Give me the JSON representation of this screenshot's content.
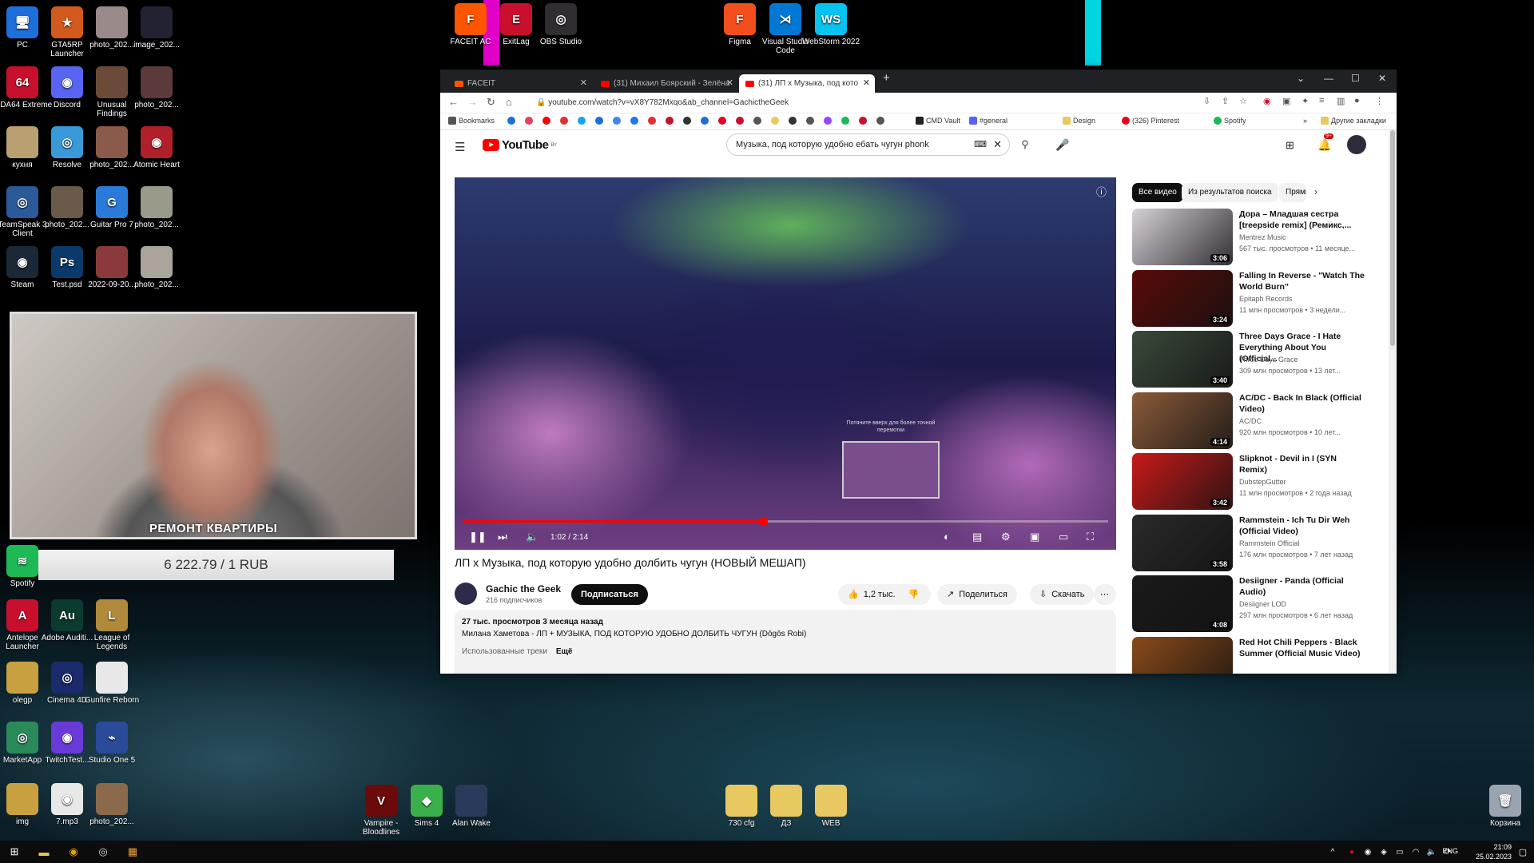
{
  "desktop": {
    "left_icons": [
      {
        "label": "PC",
        "color": "#1e6fd9",
        "glyph": "🖥"
      },
      {
        "label": "GTA5RP Launcher",
        "color": "#d25a1e",
        "glyph": "★"
      },
      {
        "label": "photo_202...",
        "color": "#9a8a8a",
        "glyph": ""
      },
      {
        "label": "image_202...",
        "color": "#222233",
        "glyph": ""
      },
      {
        "label": "AIDA64 Extreme",
        "color": "#c8102e",
        "glyph": "64"
      },
      {
        "label": "Discord",
        "color": "#5865f2",
        "glyph": "◉"
      },
      {
        "label": "Unusual Findings",
        "color": "#6b4a3a",
        "glyph": ""
      },
      {
        "label": "photo_202...",
        "color": "#5a3a3a",
        "glyph": ""
      },
      {
        "label": "кухня",
        "color": "#b8a070",
        "glyph": ""
      },
      {
        "label": "Resolve",
        "color": "#3a9ad9",
        "glyph": "◎"
      },
      {
        "label": "photo_202...",
        "color": "#8a5a4a",
        "glyph": ""
      },
      {
        "label": "Atomic Heart",
        "color": "#b0202a",
        "glyph": "◉"
      },
      {
        "label": "TeamSpeak 3 Client",
        "color": "#2a5a9a",
        "glyph": "◎"
      },
      {
        "label": "photo_202...",
        "color": "#6a5a4a",
        "glyph": ""
      },
      {
        "label": "Guitar Pro 7",
        "color": "#2a7ad9",
        "glyph": "G"
      },
      {
        "label": "photo_202...",
        "color": "#9a9a8a",
        "glyph": ""
      },
      {
        "label": "Steam",
        "color": "#1b2838",
        "glyph": "◉"
      },
      {
        "label": "Test.psd",
        "color": "#0a3a6a",
        "glyph": "Ps"
      },
      {
        "label": "2022-09-20...",
        "color": "#8a3a3a",
        "glyph": ""
      },
      {
        "label": "photo_202...",
        "color": "#aaa49a",
        "glyph": ""
      }
    ],
    "lower_icons": [
      {
        "label": "Spotify",
        "color": "#1db954",
        "glyph": "≋"
      },
      {
        "label": "Antelope Launcher",
        "color": "#c8102e",
        "glyph": "A"
      },
      {
        "label": "Adobe Auditi...",
        "color": "#0b3b2e",
        "glyph": "Au"
      },
      {
        "label": "League of Legends",
        "color": "#b08a3a",
        "glyph": "L"
      },
      {
        "label": "olegp",
        "color": "#c8a040",
        "glyph": ""
      },
      {
        "label": "Cinema 4D",
        "color": "#1a2a6a",
        "glyph": "◎"
      },
      {
        "label": "Gunfire Reborn",
        "color": "#e8e8e8",
        "glyph": ""
      },
      {
        "label": "MarketApp",
        "color": "#2a8a5a",
        "glyph": "◎"
      },
      {
        "label": "TwitchTest...",
        "color": "#6a3ad9",
        "glyph": "◉"
      },
      {
        "label": "Studio One 5",
        "color": "#2a4a9a",
        "glyph": "⌁"
      },
      {
        "label": "img",
        "color": "#c8a040",
        "glyph": ""
      },
      {
        "label": "7.mp3",
        "color": "#e8e8e8",
        "glyph": "◉"
      },
      {
        "label": "photo_202...",
        "color": "#8a6a4a",
        "glyph": ""
      }
    ],
    "top_icons": [
      {
        "label": "FACEIT AC",
        "color": "#ff5500",
        "glyph": "F"
      },
      {
        "label": "ExitLag",
        "color": "#c8102e",
        "glyph": "E"
      },
      {
        "label": "OBS Studio",
        "color": "#302e31",
        "glyph": "◎"
      },
      {
        "label": "Figma",
        "color": "#f24e1e",
        "glyph": "F"
      },
      {
        "label": "Visual Studio Code",
        "color": "#0078d4",
        "glyph": "⋊"
      },
      {
        "label": "WebStorm 2022",
        "color": "#07c3f2",
        "glyph": "WS"
      }
    ],
    "bottom_icons": [
      {
        "label": "Vampire - Bloodlines",
        "color": "#6a0a0a",
        "glyph": "V"
      },
      {
        "label": "Sims 4",
        "color": "#3ab04a",
        "glyph": "◆"
      },
      {
        "label": "Alan Wake",
        "color": "#2a3a5a",
        "glyph": ""
      },
      {
        "label": "730 cfg",
        "color": "#e8c860",
        "glyph": ""
      },
      {
        "label": "ДЗ",
        "color": "#e8c860",
        "glyph": ""
      },
      {
        "label": "WEB",
        "color": "#e8c860",
        "glyph": ""
      }
    ],
    "recycle_bin": "Корзина"
  },
  "webcam": {
    "caption": "РЕМОНТ КВАРТИРЫ"
  },
  "donation": {
    "text": "6 222.79 / 1 RUB"
  },
  "browser": {
    "tabs": [
      {
        "title": "FACEIT"
      },
      {
        "title": "(31) Михаил Боярский - Зелёна"
      },
      {
        "title": "(31) ЛП х Музыка, под кото"
      }
    ],
    "new_tab": "+",
    "url": "youtube.com/watch?v=vX8Y782Mxqo&ab_channel=GachictheGeek",
    "bookmarks": [
      {
        "label": "Bookmarks",
        "color": "#555"
      },
      {
        "label": "CMD Vault",
        "color": "#222"
      },
      {
        "label": "#general",
        "color": "#5865f2"
      },
      {
        "label": "Design",
        "color": "#e8c860"
      },
      {
        "label": "(326) Pinterest",
        "color": "#e60023"
      },
      {
        "label": "Spotify",
        "color": "#1db954"
      },
      {
        "label": "Другие закладки",
        "color": "#e8c860"
      }
    ]
  },
  "youtube": {
    "logo": "YouTube",
    "logo_sup": "BY",
    "search_query": "Музыка, под которую удобно ебать чугун phonk",
    "player": {
      "time": "1:02 / 2:14",
      "progress": 0.465,
      "preview_text": "Потяните вверх для более точной перемотки"
    },
    "video_title": "ЛП х Музыка, под которую удобно долбить чугун (НОВЫЙ МЕШАП)",
    "channel_name": "Gachic the Geek",
    "channel_subs": "216 подписчиков",
    "subscribe": "Подписаться",
    "likes": "1,2 тыс.",
    "share": "Поделиться",
    "download": "Скачать",
    "description": {
      "meta": "27 тыс. просмотров  3 месяца назад",
      "line": "Милана Хаметова - ЛП + МУЗЫКА, ПОД КОТОРУЮ УДОБНО ДОЛБИТЬ ЧУГУН (Dōgōs Robi)",
      "tracks": "Использованные треки",
      "more": "Ещё"
    },
    "chips": [
      "Все видео",
      "Из результатов поиска",
      "Прямы"
    ],
    "recommendations": [
      {
        "title": "Дора – Младшая сестра [treepside remix] (Ремикс,...",
        "channel": "Mentrez Music",
        "meta": "567 тыс. просмотров • 11 месяце...",
        "duration": "3:06",
        "color": "#d8d0d8"
      },
      {
        "title": "Falling In Reverse - \"Watch The World Burn\"",
        "channel": "Epitaph Records",
        "meta": "11 млн просмотров • 3 недели...",
        "duration": "3:24",
        "color": "#5a0a0a"
      },
      {
        "title": "Three Days Grace - I Hate Everything About You (Official...",
        "channel": "Three Days Grace",
        "meta": "309 млн просмотров • 13 лет...",
        "duration": "3:40",
        "color": "#3a4a3a"
      },
      {
        "title": "AC/DC - Back In Black (Official Video)",
        "channel": "AC/DC",
        "meta": "920 млн просмотров • 10 лет...",
        "duration": "4:14",
        "color": "#8a5a3a"
      },
      {
        "title": "Slipknot - Devil in I (SYN Remix)",
        "channel": "DubstepGutter",
        "meta": "11 млн просмотров • 2 года назад",
        "duration": "3:42",
        "color": "#c81a1a"
      },
      {
        "title": "Rammstein - Ich Tu Dir Weh (Official Video)",
        "channel": "Rammstein Official",
        "meta": "176 млн просмотров • 7 лет назад",
        "duration": "3:58",
        "color": "#2a2a2a"
      },
      {
        "title": "Desiigner - Panda (Official Audio)",
        "channel": "Desiigner LOD",
        "meta": "297 млн просмотров • 6 лет назад",
        "duration": "4:08",
        "color": "#1a1a1a"
      },
      {
        "title": "Red Hot Chili Peppers - Black Summer (Official Music Video)",
        "channel": "",
        "meta": "",
        "duration": "",
        "color": "#8a4a1a"
      }
    ]
  },
  "taskbar": {
    "lang": "ENG",
    "time": "21:09",
    "date": "25.02.2023"
  }
}
